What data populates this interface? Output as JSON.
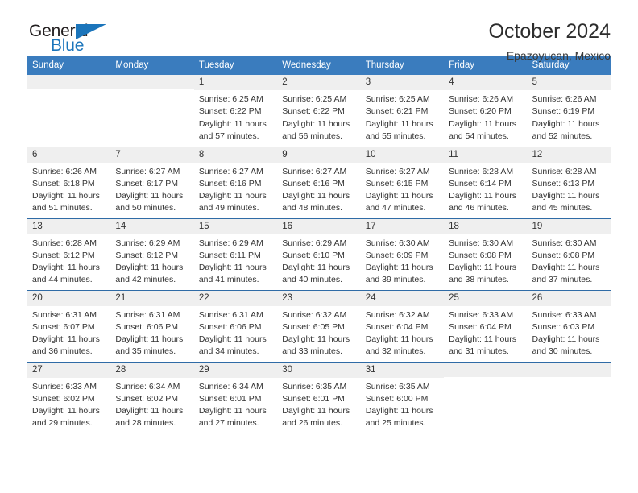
{
  "brand": {
    "name_part1": "General",
    "name_part2": "Blue",
    "accent_color": "#1b75bb"
  },
  "header": {
    "title": "October 2024",
    "subtitle": "Epazoyucan, Mexico",
    "header_bg": "#3a7cbe",
    "row_divider_color": "#2f6ba6",
    "daynum_bg": "#efefef"
  },
  "weekdays": [
    "Sunday",
    "Monday",
    "Tuesday",
    "Wednesday",
    "Thursday",
    "Friday",
    "Saturday"
  ],
  "labels": {
    "sunrise_prefix": "Sunrise:",
    "sunset_prefix": "Sunset:",
    "daylight_prefix": "Daylight:"
  },
  "weeks": [
    [
      {
        "day": "",
        "empty": true
      },
      {
        "day": "",
        "empty": true
      },
      {
        "day": "1",
        "sunrise": "Sunrise: 6:25 AM",
        "sunset": "Sunset: 6:22 PM",
        "daylight_l1": "Daylight: 11 hours",
        "daylight_l2": "and 57 minutes."
      },
      {
        "day": "2",
        "sunrise": "Sunrise: 6:25 AM",
        "sunset": "Sunset: 6:22 PM",
        "daylight_l1": "Daylight: 11 hours",
        "daylight_l2": "and 56 minutes."
      },
      {
        "day": "3",
        "sunrise": "Sunrise: 6:25 AM",
        "sunset": "Sunset: 6:21 PM",
        "daylight_l1": "Daylight: 11 hours",
        "daylight_l2": "and 55 minutes."
      },
      {
        "day": "4",
        "sunrise": "Sunrise: 6:26 AM",
        "sunset": "Sunset: 6:20 PM",
        "daylight_l1": "Daylight: 11 hours",
        "daylight_l2": "and 54 minutes."
      },
      {
        "day": "5",
        "sunrise": "Sunrise: 6:26 AM",
        "sunset": "Sunset: 6:19 PM",
        "daylight_l1": "Daylight: 11 hours",
        "daylight_l2": "and 52 minutes."
      }
    ],
    [
      {
        "day": "6",
        "sunrise": "Sunrise: 6:26 AM",
        "sunset": "Sunset: 6:18 PM",
        "daylight_l1": "Daylight: 11 hours",
        "daylight_l2": "and 51 minutes."
      },
      {
        "day": "7",
        "sunrise": "Sunrise: 6:27 AM",
        "sunset": "Sunset: 6:17 PM",
        "daylight_l1": "Daylight: 11 hours",
        "daylight_l2": "and 50 minutes."
      },
      {
        "day": "8",
        "sunrise": "Sunrise: 6:27 AM",
        "sunset": "Sunset: 6:16 PM",
        "daylight_l1": "Daylight: 11 hours",
        "daylight_l2": "and 49 minutes."
      },
      {
        "day": "9",
        "sunrise": "Sunrise: 6:27 AM",
        "sunset": "Sunset: 6:16 PM",
        "daylight_l1": "Daylight: 11 hours",
        "daylight_l2": "and 48 minutes."
      },
      {
        "day": "10",
        "sunrise": "Sunrise: 6:27 AM",
        "sunset": "Sunset: 6:15 PM",
        "daylight_l1": "Daylight: 11 hours",
        "daylight_l2": "and 47 minutes."
      },
      {
        "day": "11",
        "sunrise": "Sunrise: 6:28 AM",
        "sunset": "Sunset: 6:14 PM",
        "daylight_l1": "Daylight: 11 hours",
        "daylight_l2": "and 46 minutes."
      },
      {
        "day": "12",
        "sunrise": "Sunrise: 6:28 AM",
        "sunset": "Sunset: 6:13 PM",
        "daylight_l1": "Daylight: 11 hours",
        "daylight_l2": "and 45 minutes."
      }
    ],
    [
      {
        "day": "13",
        "sunrise": "Sunrise: 6:28 AM",
        "sunset": "Sunset: 6:12 PM",
        "daylight_l1": "Daylight: 11 hours",
        "daylight_l2": "and 44 minutes."
      },
      {
        "day": "14",
        "sunrise": "Sunrise: 6:29 AM",
        "sunset": "Sunset: 6:12 PM",
        "daylight_l1": "Daylight: 11 hours",
        "daylight_l2": "and 42 minutes."
      },
      {
        "day": "15",
        "sunrise": "Sunrise: 6:29 AM",
        "sunset": "Sunset: 6:11 PM",
        "daylight_l1": "Daylight: 11 hours",
        "daylight_l2": "and 41 minutes."
      },
      {
        "day": "16",
        "sunrise": "Sunrise: 6:29 AM",
        "sunset": "Sunset: 6:10 PM",
        "daylight_l1": "Daylight: 11 hours",
        "daylight_l2": "and 40 minutes."
      },
      {
        "day": "17",
        "sunrise": "Sunrise: 6:30 AM",
        "sunset": "Sunset: 6:09 PM",
        "daylight_l1": "Daylight: 11 hours",
        "daylight_l2": "and 39 minutes."
      },
      {
        "day": "18",
        "sunrise": "Sunrise: 6:30 AM",
        "sunset": "Sunset: 6:08 PM",
        "daylight_l1": "Daylight: 11 hours",
        "daylight_l2": "and 38 minutes."
      },
      {
        "day": "19",
        "sunrise": "Sunrise: 6:30 AM",
        "sunset": "Sunset: 6:08 PM",
        "daylight_l1": "Daylight: 11 hours",
        "daylight_l2": "and 37 minutes."
      }
    ],
    [
      {
        "day": "20",
        "sunrise": "Sunrise: 6:31 AM",
        "sunset": "Sunset: 6:07 PM",
        "daylight_l1": "Daylight: 11 hours",
        "daylight_l2": "and 36 minutes."
      },
      {
        "day": "21",
        "sunrise": "Sunrise: 6:31 AM",
        "sunset": "Sunset: 6:06 PM",
        "daylight_l1": "Daylight: 11 hours",
        "daylight_l2": "and 35 minutes."
      },
      {
        "day": "22",
        "sunrise": "Sunrise: 6:31 AM",
        "sunset": "Sunset: 6:06 PM",
        "daylight_l1": "Daylight: 11 hours",
        "daylight_l2": "and 34 minutes."
      },
      {
        "day": "23",
        "sunrise": "Sunrise: 6:32 AM",
        "sunset": "Sunset: 6:05 PM",
        "daylight_l1": "Daylight: 11 hours",
        "daylight_l2": "and 33 minutes."
      },
      {
        "day": "24",
        "sunrise": "Sunrise: 6:32 AM",
        "sunset": "Sunset: 6:04 PM",
        "daylight_l1": "Daylight: 11 hours",
        "daylight_l2": "and 32 minutes."
      },
      {
        "day": "25",
        "sunrise": "Sunrise: 6:33 AM",
        "sunset": "Sunset: 6:04 PM",
        "daylight_l1": "Daylight: 11 hours",
        "daylight_l2": "and 31 minutes."
      },
      {
        "day": "26",
        "sunrise": "Sunrise: 6:33 AM",
        "sunset": "Sunset: 6:03 PM",
        "daylight_l1": "Daylight: 11 hours",
        "daylight_l2": "and 30 minutes."
      }
    ],
    [
      {
        "day": "27",
        "sunrise": "Sunrise: 6:33 AM",
        "sunset": "Sunset: 6:02 PM",
        "daylight_l1": "Daylight: 11 hours",
        "daylight_l2": "and 29 minutes."
      },
      {
        "day": "28",
        "sunrise": "Sunrise: 6:34 AM",
        "sunset": "Sunset: 6:02 PM",
        "daylight_l1": "Daylight: 11 hours",
        "daylight_l2": "and 28 minutes."
      },
      {
        "day": "29",
        "sunrise": "Sunrise: 6:34 AM",
        "sunset": "Sunset: 6:01 PM",
        "daylight_l1": "Daylight: 11 hours",
        "daylight_l2": "and 27 minutes."
      },
      {
        "day": "30",
        "sunrise": "Sunrise: 6:35 AM",
        "sunset": "Sunset: 6:01 PM",
        "daylight_l1": "Daylight: 11 hours",
        "daylight_l2": "and 26 minutes."
      },
      {
        "day": "31",
        "sunrise": "Sunrise: 6:35 AM",
        "sunset": "Sunset: 6:00 PM",
        "daylight_l1": "Daylight: 11 hours",
        "daylight_l2": "and 25 minutes."
      },
      {
        "day": "",
        "empty": true
      },
      {
        "day": "",
        "empty": true
      }
    ]
  ]
}
